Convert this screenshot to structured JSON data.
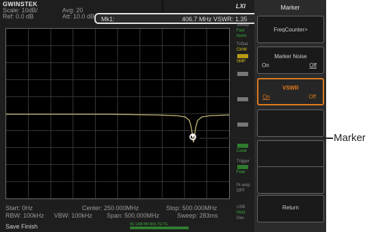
{
  "header": {
    "brand": "GWINSTEK",
    "scale": "Scale: 10dB/",
    "ref": "Ref: 0.0 dB",
    "avg": "Avg: 20",
    "att": "Att: 10.0 dB"
  },
  "marker_readout": {
    "label": "Mk1:",
    "value": "406.7 MHz VSWR: 1.35"
  },
  "side_indicators": {
    "lxi": "LXI",
    "sweep_title": "Sweep",
    "sweep_fast": "Fast",
    "sweep_norm": "Norm",
    "trdet_title": "Tr/Det",
    "trdet_clrw": "Clr/W",
    "trdet_smp": "SMP",
    "cond_title": "Cond",
    "trigger_title": "Trigger",
    "trigger_free": "Free",
    "preamp_title": "Pr-amp",
    "preamp_state": "OFF",
    "usb_title": "USB",
    "usb_host": "Host",
    "usb_dev": "Dev"
  },
  "footer": {
    "start": "Start: 0Hz",
    "center": "Center: 250.000MHz",
    "stop": "Stop: 500.000MHz",
    "rbw": "RBW: 100kHz",
    "vbw": "VBW: 100kHz",
    "span": "Span: 500.000MHz",
    "sweep": "Sweep: 283ms",
    "status": "Save Finish",
    "leds": "AC USB 8W AVG TG TG"
  },
  "menu": {
    "title": "Marker",
    "freq_counter": "FreqCounter>",
    "marker_noise": "Marker Noise",
    "marker_noise_on": "On",
    "marker_noise_off": "Off",
    "vswr": "VSWR",
    "vswr_on": "On",
    "vswr_off": "Off",
    "return": "Return"
  },
  "annotation": {
    "marker_label": "Marker"
  },
  "colors": {
    "trace": "#c8b97a",
    "active_border": "#e07a1c",
    "grid": "#3a3a3a"
  }
}
